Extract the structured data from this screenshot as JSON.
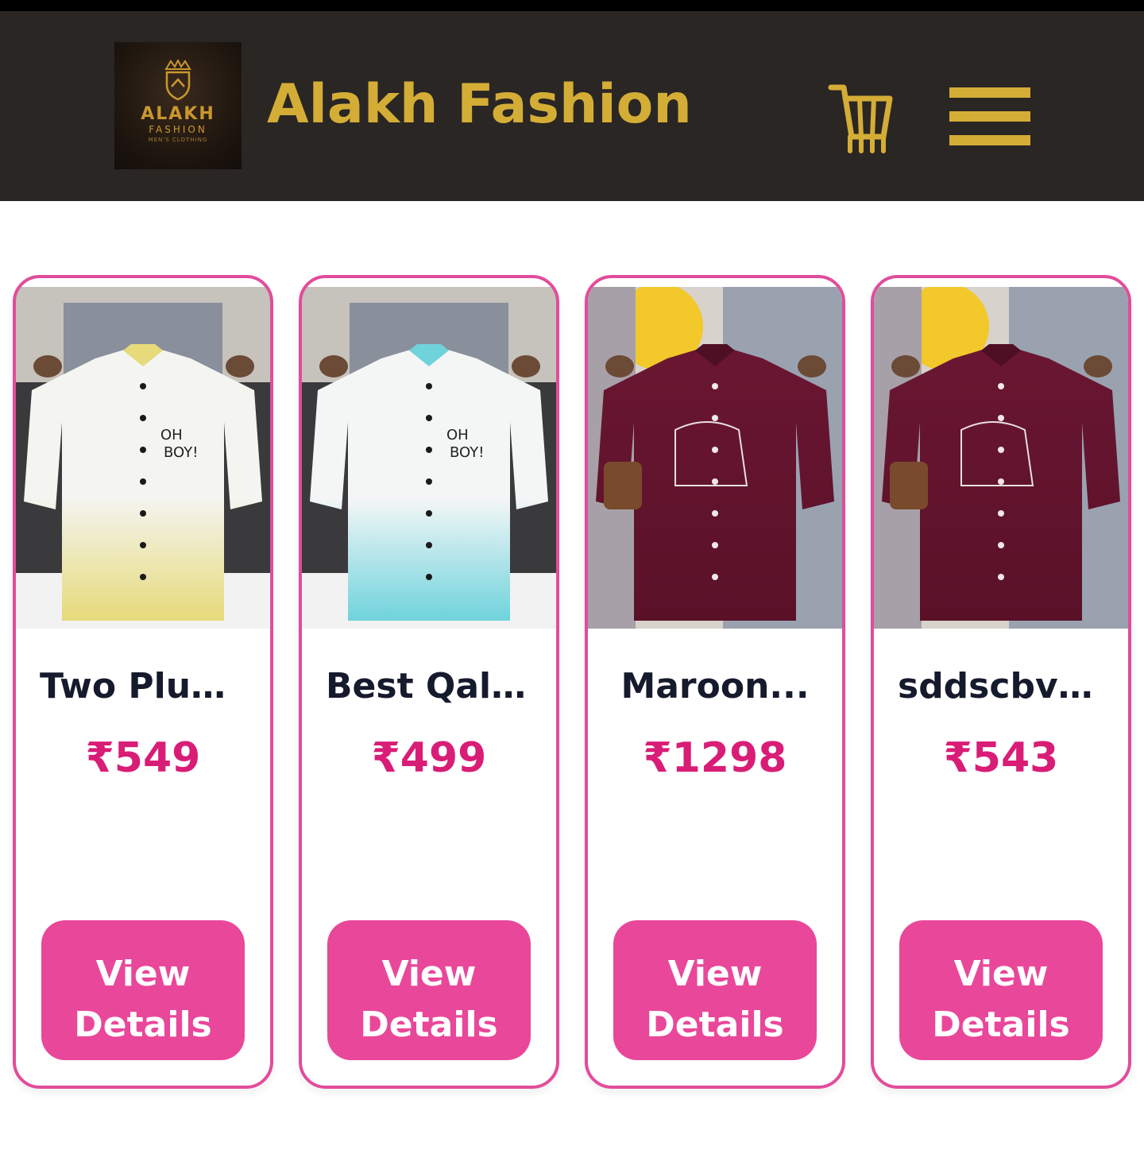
{
  "header": {
    "logo": {
      "name": "ALAKH",
      "sub": "FASHION",
      "tag": "MEN'S CLOTHING"
    },
    "brand": "Alakh Fashion",
    "cart_icon": "cart-icon",
    "menu_icon": "hamburger-menu-icon"
  },
  "colors": {
    "header_bg": "#2a2624",
    "gold": "#d4ad36",
    "card_border": "#e24c9b",
    "price": "#d91d76",
    "button": "#e9479a",
    "title": "#151a2c"
  },
  "products": [
    {
      "title": "Two Plus...",
      "price": "₹549",
      "button_line1": "View",
      "button_line2": "Details",
      "shirt_color": "#f4f4f0",
      "shirt_accent": "#e6da7a",
      "print_text": "OH BOY!"
    },
    {
      "title": "Best Qalit...",
      "price": "₹499",
      "button_line1": "View",
      "button_line2": "Details",
      "shirt_color": "#f4f6f6",
      "shirt_accent": "#6fd3dc",
      "print_text": "OH BOY!"
    },
    {
      "title": "Maroon...",
      "price": "₹1298",
      "button_line1": "View",
      "button_line2": "Details",
      "shirt_color": "#6a1632",
      "shirt_accent": "#7a4a2c",
      "print_text": ""
    },
    {
      "title": "sddscbvdcs",
      "price": "₹543",
      "button_line1": "View",
      "button_line2": "Details",
      "shirt_color": "#6a1632",
      "shirt_accent": "#7a4a2c",
      "print_text": ""
    }
  ]
}
